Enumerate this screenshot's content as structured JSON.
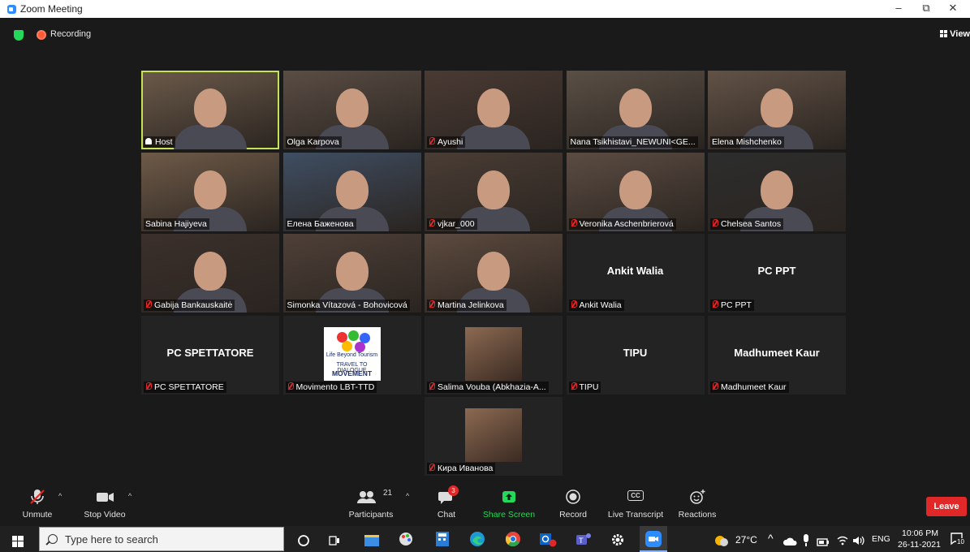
{
  "window": {
    "title": "Zoom Meeting",
    "min": "–",
    "max": "⧉",
    "close": "✕"
  },
  "status": {
    "recording": "Recording",
    "view": "View"
  },
  "participants": [
    {
      "name": "Host",
      "kind": "video",
      "host": true
    },
    {
      "name": "Olga Karpova",
      "kind": "video"
    },
    {
      "name": "Ayushi",
      "kind": "video",
      "muted": true
    },
    {
      "name": "Nana Tsikhistavi_NEWUNI<GE...",
      "kind": "video"
    },
    {
      "name": "Elena Mishchenko",
      "kind": "video"
    },
    {
      "name": "Sabina Hajiyeva",
      "kind": "video"
    },
    {
      "name": "Елена Баженова",
      "kind": "video"
    },
    {
      "name": "vjkar_000",
      "kind": "video",
      "muted": true
    },
    {
      "name": "Veronika Aschenbrierová",
      "kind": "video",
      "muted": true
    },
    {
      "name": "Chelsea Santos",
      "kind": "video",
      "muted": true
    },
    {
      "name": "Gabija Bankauskaitė",
      "kind": "video",
      "muted": true
    },
    {
      "name": "Simonka Vítazová - Bohovicová",
      "kind": "video"
    },
    {
      "name": "Martina Jelinkova",
      "kind": "video",
      "muted": true
    },
    {
      "name": "Ankit Walia",
      "display": "Ankit Walia",
      "kind": "name",
      "muted": true
    },
    {
      "name": "PC PPT",
      "display": "PC PPT",
      "kind": "name",
      "muted": true
    },
    {
      "name": "PC SPETTATORE",
      "display": "PC SPETTATORE",
      "kind": "name",
      "muted": true
    },
    {
      "name": "Movimento LBT-TTD",
      "kind": "logo",
      "muted": true
    },
    {
      "name": "Salima Vouba (Abkhazia-A...",
      "kind": "avatar",
      "muted": true
    },
    {
      "name": "TIPU",
      "display": "TIPU",
      "kind": "name",
      "muted": true
    },
    {
      "name": "Madhumeet Kaur",
      "display": "Madhumeet Kaur",
      "kind": "name",
      "muted": true
    },
    {
      "name": "Кира Иванова",
      "kind": "avatar",
      "muted": true
    }
  ],
  "logo": {
    "line1": "Life Beyond Tourism",
    "line2": "TRAVEL TO DIALOGUE",
    "line3": "MOVEMENT"
  },
  "toolbar": {
    "unmute": "Unmute",
    "stop_video": "Stop Video",
    "participants": "Participants",
    "participants_count": "21",
    "chat": "Chat",
    "chat_badge": "3",
    "share_screen": "Share Screen",
    "record": "Record",
    "live_transcript": "Live Transcript",
    "cc": "CC",
    "reactions": "Reactions",
    "leave": "Leave"
  },
  "taskbar": {
    "search_placeholder": "Type here to search",
    "weather": "27°C",
    "lang": "ENG",
    "time": "10:06 PM",
    "date": "26-11-2021",
    "notif": "10"
  },
  "colors": {
    "accent": "#2d8cff",
    "host_border": "#c6e256",
    "leave": "#e02828",
    "share": "#23d959"
  }
}
